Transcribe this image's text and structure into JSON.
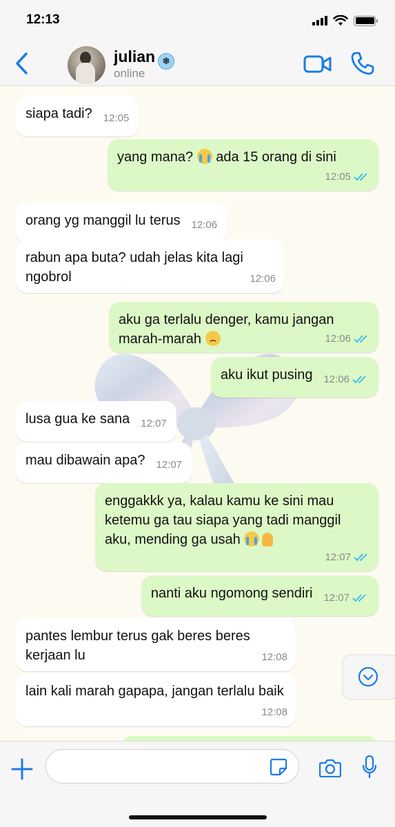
{
  "status_bar": {
    "time": "12:13"
  },
  "header": {
    "name": "julian",
    "status": "online"
  },
  "messages": [
    {
      "dir": "in",
      "text": "siapa tadi?",
      "time": "12:05"
    },
    {
      "dir": "out",
      "text": "yang mana? 😭 ada 15 orang di sini",
      "time": "12:05"
    },
    {
      "dir": "in",
      "text": "orang yg manggil lu terus",
      "time": "12:06"
    },
    {
      "dir": "in",
      "text": "rabun apa buta? udah jelas kita lagi ngobrol",
      "time": "12:06"
    },
    {
      "dir": "out",
      "text": "aku ga terlalu denger, kamu jangan marah-marah 😞",
      "time": "12:06"
    },
    {
      "dir": "out",
      "text": "aku ikut pusing",
      "time": "12:06"
    },
    {
      "dir": "in",
      "text": "lusa gua ke sana",
      "time": "12:07"
    },
    {
      "dir": "in",
      "text": "mau dibawain apa?",
      "time": "12:07"
    },
    {
      "dir": "out",
      "text": "enggakkk ya, kalau kamu ke sini mau ketemu ga tau siapa yang tadi manggil aku, mending ga usah 😭🙏",
      "time": "12:07"
    },
    {
      "dir": "out",
      "text": "nanti aku ngomong sendiri",
      "time": "12:07"
    },
    {
      "dir": "in",
      "text": "pantes lembur terus gak beres beres kerjaan lu",
      "time": "12:08"
    },
    {
      "dir": "in",
      "text": "lain kali marah gapapa, jangan terlalu baik",
      "time": "12:08"
    }
  ],
  "colors": {
    "accent": "#1a7ce6",
    "outgoing": "#dcf8c6",
    "incoming": "#ffffff",
    "read_ticks": "#34b7f1"
  },
  "icons": [
    "back-chevron",
    "video-camera",
    "phone",
    "scroll-down-chevron",
    "plus",
    "sticker",
    "camera",
    "microphone"
  ]
}
